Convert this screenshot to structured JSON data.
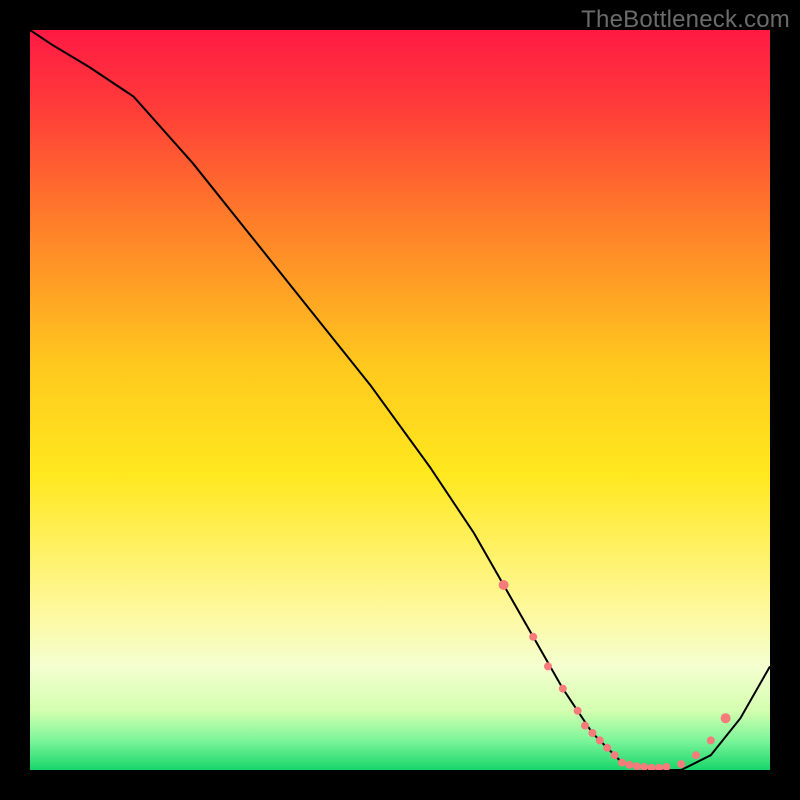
{
  "watermark": "TheBottleneck.com",
  "chart_data": {
    "type": "line",
    "title": "",
    "xlabel": "",
    "ylabel": "",
    "xlim": [
      0,
      100
    ],
    "ylim": [
      0,
      100
    ],
    "gradient_stops": [
      {
        "offset": 0.0,
        "color": "#ff1a44"
      },
      {
        "offset": 0.1,
        "color": "#ff3a3a"
      },
      {
        "offset": 0.25,
        "color": "#ff7a2a"
      },
      {
        "offset": 0.45,
        "color": "#ffc81e"
      },
      {
        "offset": 0.6,
        "color": "#ffe81e"
      },
      {
        "offset": 0.78,
        "color": "#fff89a"
      },
      {
        "offset": 0.86,
        "color": "#f4ffd0"
      },
      {
        "offset": 0.92,
        "color": "#d4ffb0"
      },
      {
        "offset": 0.96,
        "color": "#7cf59a"
      },
      {
        "offset": 1.0,
        "color": "#17d66a"
      }
    ],
    "series": [
      {
        "name": "bottleneck-curve",
        "x": [
          0,
          3,
          8,
          14,
          22,
          30,
          38,
          46,
          54,
          60,
          64,
          68,
          72,
          76,
          80,
          84,
          88,
          92,
          96,
          100
        ],
        "y": [
          100,
          98,
          95,
          91,
          82,
          72,
          62,
          52,
          41,
          32,
          25,
          18,
          11,
          5,
          1,
          0,
          0,
          2,
          7,
          14
        ]
      }
    ],
    "markers": {
      "name": "highlight-dots",
      "color": "#f77b7b",
      "x": [
        64,
        68,
        70,
        72,
        74,
        75,
        76,
        77,
        78,
        79,
        80,
        81,
        82,
        83,
        84,
        85,
        86,
        88,
        90,
        92,
        94
      ],
      "y": [
        25,
        18,
        14,
        11,
        8,
        6,
        5,
        4,
        3,
        2,
        1,
        0.7,
        0.5,
        0.4,
        0.3,
        0.3,
        0.4,
        0.8,
        2,
        4,
        7
      ]
    }
  }
}
